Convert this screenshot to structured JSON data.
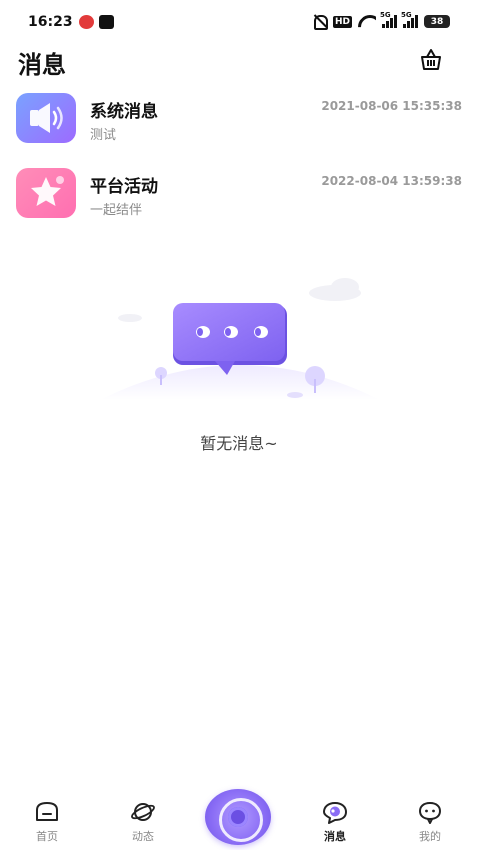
{
  "status_bar": {
    "time": "16:23",
    "hd": "HD",
    "net1": "5G",
    "net2": "5G",
    "battery": "38"
  },
  "header": {
    "title": "消息",
    "clear_icon": "basket-icon"
  },
  "messages": [
    {
      "title": "系统消息",
      "subtitle": "测试",
      "time": "2021-08-06 15:35:38",
      "icon": "speaker-icon",
      "color": "#8b7dff"
    },
    {
      "title": "平台活动",
      "subtitle": "一起结伴",
      "time": "2022-08-04 13:59:38",
      "icon": "star-icon",
      "color": "#ff7eb6"
    }
  ],
  "empty_state": {
    "text": "暂无消息~",
    "illustration": "chat-bubble-illustration"
  },
  "bottom_nav": {
    "items": [
      {
        "label": "首页",
        "icon": "home-icon",
        "active": false
      },
      {
        "label": "动态",
        "icon": "planet-icon",
        "active": false
      },
      {
        "label": "消息",
        "icon": "message-icon",
        "active": true
      },
      {
        "label": "我的",
        "icon": "profile-icon",
        "active": false
      }
    ],
    "center_icon": "camera-lens-icon"
  },
  "colors": {
    "accent": "#8a6df5",
    "text_primary": "#111111",
    "text_secondary": "#8a8a8a"
  }
}
